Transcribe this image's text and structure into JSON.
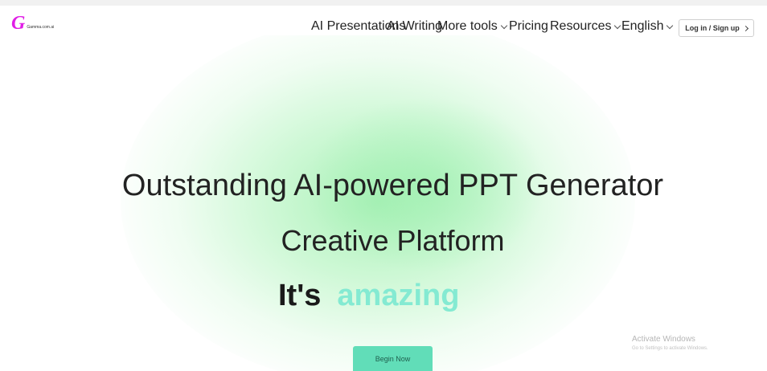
{
  "header": {
    "logo_mark": "G",
    "logo_text": "Gamma.com.ai",
    "nav": [
      {
        "label": "AI Presentations"
      },
      {
        "label": "AI Writing"
      },
      {
        "label": "More tools"
      },
      {
        "label": "Pricing"
      },
      {
        "label": "Resources"
      },
      {
        "label": "English"
      }
    ],
    "login_label": "Log in / Sign up"
  },
  "hero": {
    "title": "Outstanding AI-powered PPT Generator",
    "subtitle": "Creative Platform",
    "tag_prefix": "It's",
    "tag_word": "amazing",
    "cta_label": "Begin Now"
  },
  "watermark": {
    "title": "Activate Windows",
    "subtitle": "Go to Settings to activate Windows."
  },
  "colors": {
    "logo": "#e01ee6",
    "accent": "#61ddb8",
    "amazing_text": "#84ead2",
    "glow": "#a6f0b4"
  },
  "icons": {
    "dropdown": "chevron-down-icon",
    "login_arrow": "chevron-right-icon"
  }
}
